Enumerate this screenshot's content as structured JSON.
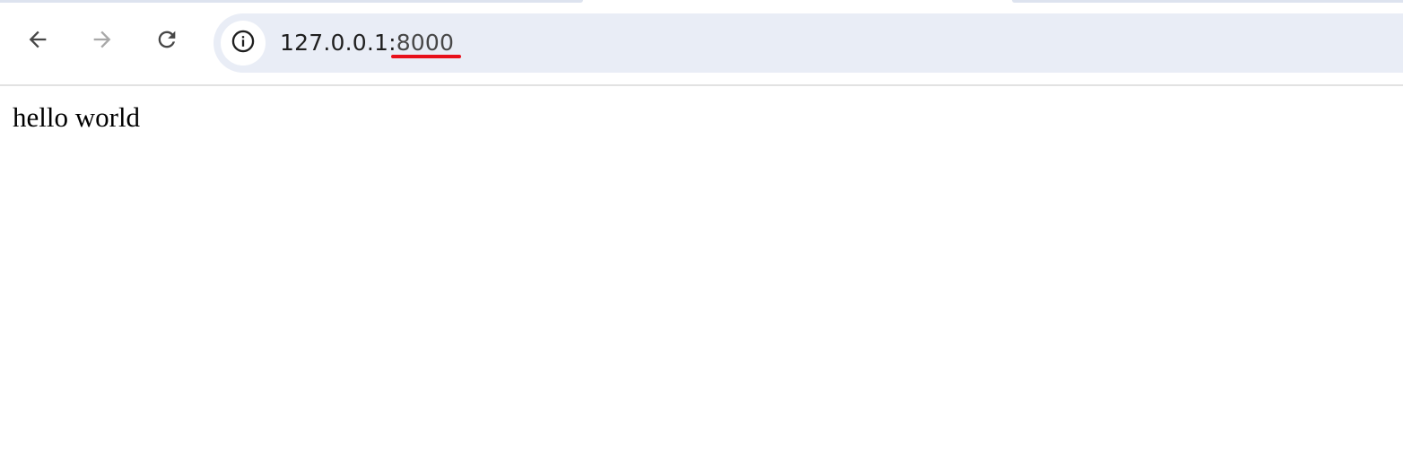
{
  "browser": {
    "toolbar": {
      "back_icon": "arrow-left-icon",
      "forward_icon": "arrow-right-icon",
      "reload_icon": "reload-icon",
      "forward_enabled": false
    },
    "omnibox": {
      "site_info_icon": "info-circle-icon",
      "url_host": "127.0.0.1:",
      "url_port": "8000",
      "background_color": "#e9edf6"
    },
    "annotation": {
      "underline_target": "8000",
      "underline_color": "#e8101b"
    }
  },
  "page": {
    "body_text": "hello world"
  }
}
